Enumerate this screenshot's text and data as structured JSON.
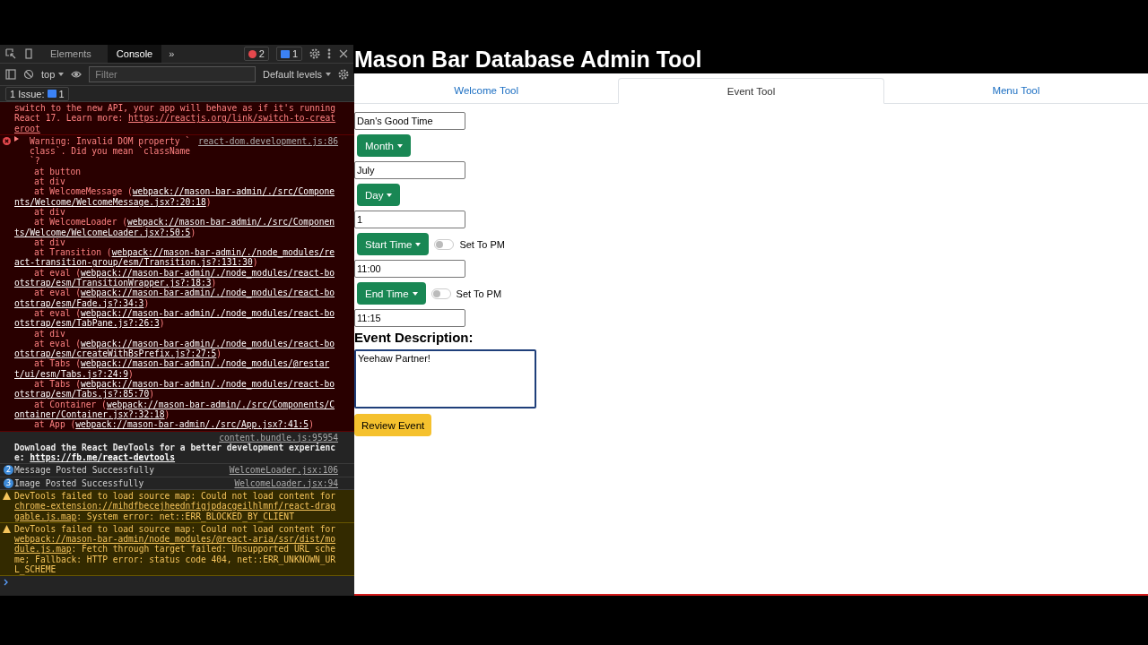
{
  "devtools": {
    "tabs": [
      {
        "label": "Elements",
        "selected": false
      },
      {
        "label": "Console",
        "selected": true
      }
    ],
    "more_tabs": "»",
    "error_count": "2",
    "info_count": "1",
    "context": "top",
    "filter": {
      "placeholder": "Filter"
    },
    "levels": "Default levels",
    "issues": {
      "label": "1 Issue:",
      "count": "1"
    },
    "messages": [
      {
        "kind": "error",
        "text": "switch to the new API, your app will behave as if it's running React 17. Learn more: ",
        "link": "https://reactjs.org/link/switch-to-createroot"
      },
      {
        "kind": "error",
        "expanded": false,
        "source": "react-dom.development.js:86",
        "text": "Warning: Invalid DOM property `class`. Did you mean `className`?",
        "stack": [
          {
            "text": "at button"
          },
          {
            "text": "at div"
          },
          {
            "text": "at WelcomeMessage (",
            "link": "webpack://mason-bar-admin/./src/Components/Welcome/WelcomeMessage.jsx?:20:18",
            "end": ")"
          },
          {
            "text": "at div"
          },
          {
            "text": "at WelcomeLoader (",
            "link": "webpack://mason-bar-admin/./src/Components/Welcome/WelcomeLoader.jsx?:50:5",
            "end": ")"
          },
          {
            "text": "at div"
          },
          {
            "text": "at Transition (",
            "link": "webpack://mason-bar-admin/./node_modules/react-transition-group/esm/Transition.js?:131:30",
            "end": ")"
          },
          {
            "text": "at eval (",
            "link": "webpack://mason-bar-admin/./node_modules/react-bootstrap/esm/TransitionWrapper.js?:18:3",
            "end": ")"
          },
          {
            "text": "at eval (",
            "link": "webpack://mason-bar-admin/./node_modules/react-bootstrap/esm/Fade.js?:34:3",
            "end": ")"
          },
          {
            "text": "at eval (",
            "link": "webpack://mason-bar-admin/./node_modules/react-bootstrap/esm/TabPane.js?:26:3",
            "end": ")"
          },
          {
            "text": "at div"
          },
          {
            "text": "at eval (",
            "link": "webpack://mason-bar-admin/./node_modules/react-bootstrap/esm/createWithBsPrefix.js?:27:5",
            "end": ")"
          },
          {
            "text": "at Tabs (",
            "link": "webpack://mason-bar-admin/./node_modules/@restart/ui/esm/Tabs.js?:24:9",
            "end": ")"
          },
          {
            "text": "at Tabs (",
            "link": "webpack://mason-bar-admin/./node_modules/react-bootstrap/esm/Tabs.js?:85:70",
            "end": ")"
          },
          {
            "text": "at Container (",
            "link": "webpack://mason-bar-admin/./src/Components/Container/Container.jsx?:32:18",
            "end": ")"
          },
          {
            "text": "at App (",
            "link": "webpack://mason-bar-admin/./src/App.jsx?:41:5",
            "end": ")"
          }
        ]
      },
      {
        "kind": "log",
        "source": "content.bundle.js:95954",
        "text": "Download the React DevTools for a better development experience: ",
        "link": "https://fb.me/react-devtools"
      },
      {
        "kind": "info",
        "count": "2",
        "source": "WelcomeLoader.jsx:106",
        "text": "Message Posted Successfully"
      },
      {
        "kind": "info",
        "count": "3",
        "source": "WelcomeLoader.jsx:94",
        "text": "Image Posted Successfully"
      },
      {
        "kind": "warning",
        "text": "DevTools failed to load source map: Could not load content for ",
        "link": "chrome-extension://mihdfbecejheednfigjpdacgeilhlmnf/react-draggable.js.map",
        "rest": ": System error: net::ERR_BLOCKED_BY_CLIENT"
      },
      {
        "kind": "warning",
        "text": "DevTools failed to load source map: Could not load content for ",
        "link": "webpack://mason-bar-admin/node_modules/@react-aria/ssr/dist/module.js.map",
        "rest": ": Fetch through target failed: Unsupported URL scheme; Fallback: HTTP error: status code 404, net::ERR_UNKNOWN_URL_SCHEME"
      }
    ]
  },
  "app": {
    "title": "Mason Bar Database Admin Tool",
    "tabs": [
      {
        "label": "Welcome Tool",
        "selected": false
      },
      {
        "label": "Event Tool",
        "selected": true
      },
      {
        "label": "Menu Tool",
        "selected": false
      }
    ],
    "form": [
      {
        "kind": "input",
        "value": "Dan's Good Time"
      },
      {
        "kind": "dropdown",
        "label": "Month"
      },
      {
        "kind": "input",
        "value": "July"
      },
      {
        "kind": "dropdown",
        "label": "Day"
      },
      {
        "kind": "input",
        "value": "1"
      },
      {
        "kind": "dropdown",
        "label": "Start Time",
        "toggle": {
          "label": "Set To PM",
          "on": false
        }
      },
      {
        "kind": "input",
        "value": "11:00"
      },
      {
        "kind": "dropdown",
        "label": "End Time",
        "toggle": {
          "label": "Set To PM",
          "on": false
        }
      },
      {
        "kind": "input",
        "value": "11:15"
      },
      {
        "kind": "heading",
        "text": "Event Description:"
      },
      {
        "kind": "textarea",
        "value": "Yeehaw Partner!",
        "focused": true
      },
      {
        "kind": "button",
        "label": "Review Event"
      }
    ]
  }
}
